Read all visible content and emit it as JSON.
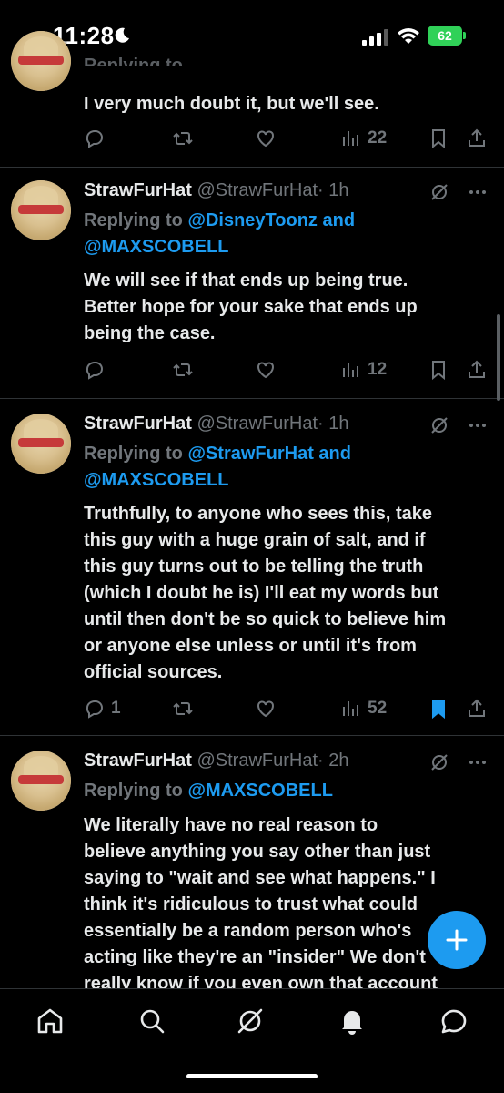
{
  "status_bar": {
    "time": "11:28",
    "battery": "62"
  },
  "tweets": [
    {
      "id": "t0",
      "partial_reply_line": "Replying to",
      "text": "I very much doubt it, but we'll see.",
      "replies": "",
      "views": "22",
      "bookmarked": false
    },
    {
      "id": "t1",
      "name": "StrawFurHat",
      "handle": "@StrawFurHat",
      "time": "· 1h",
      "replying_prefix": "Replying to ",
      "mention_1": "@DisneyToonz",
      "mention_join": " and",
      "mention_2": "@MAXSCOBELL",
      "text_lines": [
        "We will see if that ends up being true.",
        "Better hope for your sake that ends up",
        "being the case."
      ],
      "replies": "",
      "views": "12",
      "bookmarked": false
    },
    {
      "id": "t2",
      "name": "StrawFurHat",
      "handle": "@StrawFurHat",
      "time": "· 1h",
      "replying_prefix": "Replying to ",
      "mention_1": "@StrawFurHat",
      "mention_join": " and",
      "mention_2": "@MAXSCOBELL",
      "text_lines": [
        "Truthfully, to anyone who sees this, take",
        "this guy with a huge grain of salt, and if",
        "this guy turns out to be telling the truth",
        "(which I doubt he is) I'll eat my words but",
        "until then don't be so quick to believe him",
        "or anyone else unless or until it's from",
        "official sources."
      ],
      "replies": "1",
      "views": "52",
      "bookmarked": true
    },
    {
      "id": "t3",
      "name": "StrawFurHat",
      "handle": "@StrawFurHat",
      "time": "· 2h",
      "replying_prefix": "Replying to ",
      "mention_1": "@MAXSCOBELL",
      "text_lines": [
        "We literally have no real reason to",
        "believe anything you say other than just",
        "saying to \"wait and see what happens.\" I",
        "think it's ridiculous to trust what could",
        "essentially be a random person who's",
        "acting like they're an \"insider\" We don't",
        "really know if you even own that account"
      ]
    }
  ],
  "colors": {
    "background": "#000000",
    "text": "#e7e9ea",
    "muted": "#71767b",
    "accent": "#1d9bf0",
    "divider": "#2f3336",
    "battery": "#30d158"
  },
  "nav": {
    "items": [
      "home-icon",
      "search-icon",
      "grok-icon",
      "notifications-icon",
      "messages-icon"
    ],
    "fab_icon": "plus-icon"
  }
}
